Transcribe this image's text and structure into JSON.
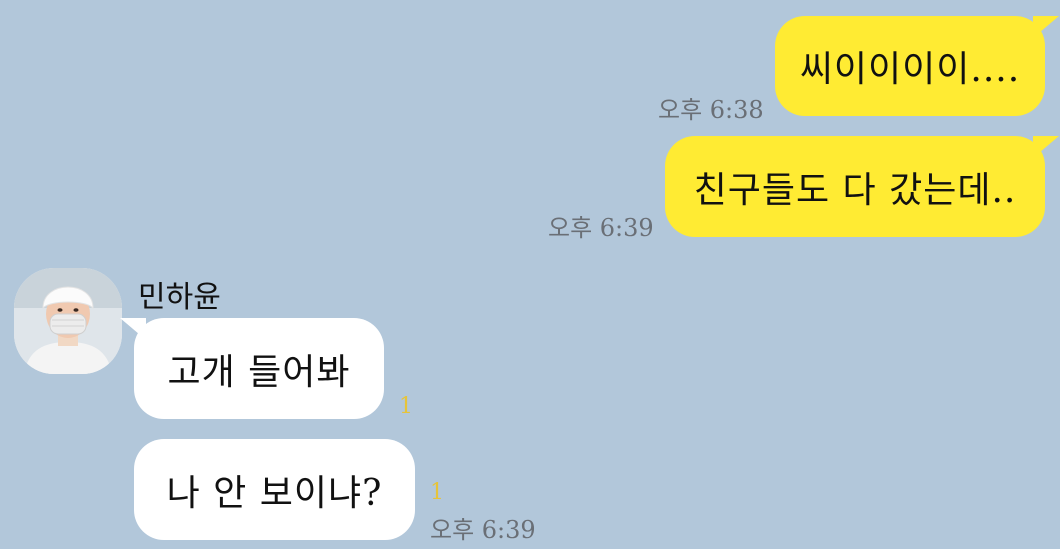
{
  "messages_out": [
    {
      "text": "씨이이이이....",
      "time": "오후 6:38"
    },
    {
      "text": "친구들도 다 갔는데..",
      "time": "오후 6:39"
    }
  ],
  "sender": {
    "name": "민하윤",
    "avatar_icon": "profile-photo-masked-person"
  },
  "messages_in": [
    {
      "text": "고개 들어봐",
      "unread": "1"
    },
    {
      "text": "나 안 보이냐?",
      "unread": "1",
      "time": "오후 6:39"
    }
  ],
  "colors": {
    "background": "#b2c7da",
    "my_bubble": "#ffeb33",
    "their_bubble": "#ffffff",
    "unread": "#e6c43a"
  }
}
